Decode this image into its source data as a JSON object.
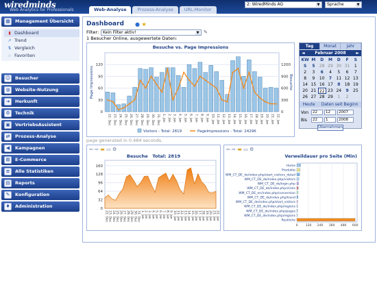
{
  "header": {
    "logo": "wiredminds",
    "tagline": "Web Analytics for Professionals",
    "tabs": [
      {
        "label": "Web-Analyse",
        "active": true
      },
      {
        "label": "Prozess-Analyse",
        "active": false
      },
      {
        "label": "URL-Monitor",
        "active": false
      }
    ],
    "company_select": "2: WiredMinds AG",
    "language_select": "Sprache"
  },
  "sidebar": {
    "items": [
      {
        "label": "Management Übersicht",
        "icon": "dashboard-icon"
      },
      {
        "label": "Besucher",
        "icon": "users-icon"
      },
      {
        "label": "Website-Nutzung",
        "icon": "globe-icon"
      },
      {
        "label": "Herkunft",
        "icon": "arrow-icon"
      },
      {
        "label": "Technik",
        "icon": "gear-icon"
      },
      {
        "label": "VertriebsAssistent",
        "icon": "briefcase-icon"
      },
      {
        "label": "Prozess-Analyse",
        "icon": "process-icon"
      },
      {
        "label": "Kampagnen",
        "icon": "megaphone-icon"
      },
      {
        "label": "E-Commerce",
        "icon": "cart-icon"
      },
      {
        "label": "Alle Statistiken",
        "icon": "list-icon"
      },
      {
        "label": "Reports",
        "icon": "report-icon"
      },
      {
        "label": "Konfiguration",
        "icon": "wrench-icon"
      },
      {
        "label": "Administration",
        "icon": "admin-icon"
      }
    ],
    "subitems": [
      {
        "label": "Dashboard",
        "icon": "bar-chart-icon",
        "active": true
      },
      {
        "label": "Trend",
        "icon": "trend-icon",
        "active": false
      },
      {
        "label": "Vergleich",
        "icon": "compare-icon",
        "active": false
      },
      {
        "label": "Favoriten",
        "icon": "star-icon",
        "active": false
      }
    ]
  },
  "main": {
    "title": "Dashboard",
    "filter_label": "Filter:",
    "filter_value": "Kein Filter aktiv!",
    "online_text": "1 Besucher Online, ausgewertete Daten:",
    "generated_note": "page generated in 0.484 seconds.",
    "lower_left_title": "Besuche",
    "lower_left_total": "Total: 2819",
    "lower_right_title": "Verweildauer pro Seite (Min)"
  },
  "calendar": {
    "tabs": [
      "Tag",
      "Monat",
      "Jahr"
    ],
    "month": "Februar 2008",
    "prev": "◄",
    "next": "►",
    "weekdays": [
      "KW",
      "M",
      "D",
      "M",
      "D",
      "F",
      "S",
      "S"
    ],
    "weeks": [
      [
        "5",
        "28",
        "29",
        "30",
        "31",
        "1",
        "2",
        "3"
      ],
      [
        "6",
        "4",
        "5",
        "6",
        "7",
        "8",
        "9",
        "10"
      ],
      [
        "7",
        "11",
        "12",
        "13",
        "14",
        "15",
        "16",
        "17"
      ],
      [
        "8",
        "18",
        "19",
        "20",
        "21",
        "22",
        "23",
        "24"
      ],
      [
        "9",
        "25",
        "26",
        "27",
        "28",
        "29",
        "1",
        "2"
      ]
    ],
    "link_today": "Heute",
    "link_since": "Daten seit Beginn",
    "from_label": "Von",
    "to_label": "Bis",
    "from": {
      "day": "22",
      "month": "12",
      "year": "2007"
    },
    "to": {
      "day": "22",
      "month": "1",
      "year": "2008"
    },
    "apply": "Übernehmen"
  },
  "chart_data": [
    {
      "type": "bar",
      "title": "Besuche vs. Page Impressions",
      "ylabel": "Page Impressions",
      "ylabel_right": "Besuche",
      "ylim": [
        0,
        150
      ],
      "ylim_right": [
        0,
        1500
      ],
      "yticks": [
        0,
        30,
        60,
        90,
        120
      ],
      "yticks_right": [
        0,
        300,
        600,
        900,
        1200
      ],
      "categories": [
        "22. Dec",
        "23. Dec",
        "24. Dec",
        "25. Dec",
        "26. Dec",
        "27. Dec",
        "28. Dec",
        "29. Dec",
        "30. Dec",
        "31. Dec",
        "1. Jan",
        "2. Jan",
        "3. Jan",
        "4. Jan",
        "5. Jan",
        "6. Jan",
        "7. Jan",
        "8. Jan",
        "9. Jan",
        "10. Jan",
        "11. Jan",
        "12. Jan",
        "13. Jan",
        "14. Jan",
        "15. Jan",
        "16. Jan",
        "17. Jan",
        "18. Jan",
        "19. Jan",
        "20. Jan",
        "21. Jan",
        "22. Jan"
      ],
      "series": [
        {
          "name": "Visitors",
          "legend": "Visitors - Total: 2819",
          "color": "#9cc6e6",
          "values": [
            50,
            48,
            18,
            20,
            40,
            62,
            110,
            108,
            112,
            88,
            100,
            112,
            112,
            92,
            62,
            120,
            110,
            126,
            100,
            118,
            102,
            80,
            44,
            130,
            140,
            90,
            132,
            102,
            88,
            60,
            62,
            60
          ]
        },
        {
          "name": "PageImpressions",
          "legend": "PageImpressions - Total: 24296",
          "color": "#f08a1e",
          "values": [
            300,
            250,
            50,
            100,
            200,
            300,
            800,
            600,
            900,
            700,
            500,
            1100,
            300,
            600,
            1000,
            800,
            650,
            900,
            800,
            700,
            600,
            300,
            250,
            1000,
            1100,
            600,
            1000,
            500,
            350,
            250,
            200,
            200
          ]
        }
      ]
    },
    {
      "type": "area",
      "title": "Besuche",
      "total": "Total: 2819",
      "ylim": [
        0,
        180
      ],
      "yticks": [
        0,
        32,
        64,
        96,
        128,
        160
      ],
      "categories": [
        "22. Dec",
        "23. Dec",
        "24. Dec",
        "25. Dec",
        "26. Dec",
        "27. Dec",
        "28. Dec",
        "29. Dec",
        "30. Dec",
        "31. Dec",
        "1. Jan",
        "2. Jan",
        "3. Jan",
        "4. Jan",
        "5. Jan",
        "6. Jan",
        "7. Jan",
        "8. Jan",
        "9. Jan",
        "10. Jan",
        "11. Jan",
        "12. Jan",
        "13. Jan",
        "14. Jan",
        "15. Jan",
        "16. Jan",
        "17. Jan",
        "18. Jan",
        "19. Jan",
        "20. Jan",
        "21. Jan",
        "22. Jan"
      ],
      "values": [
        40,
        50,
        35,
        30,
        55,
        72,
        118,
        126,
        106,
        82,
        96,
        120,
        121,
        88,
        60,
        115,
        124,
        132,
        102,
        128,
        104,
        70,
        54,
        144,
        152,
        92,
        130,
        100,
        86,
        60,
        58,
        64
      ],
      "color": "#f08a1e"
    },
    {
      "type": "bar",
      "orientation": "horizontal",
      "title": "Verweildauer pro Seite (Min)",
      "xticks": [
        0,
        120,
        240,
        360,
        480,
        600
      ],
      "xlim": [
        0,
        620
      ],
      "categories": [
        "Home",
        "Produkte",
        "WM_CT_DE_de/index.php/start_visitors_detail",
        "WM_CT_DE_de/index.php/visitors",
        "WM_CT_DE_de/login.php",
        "WM_CT_DE_de/index.php/clicks",
        "WM_CT_DE_en/index.php/conversion",
        "WM_CT_DE_de/index.php/trend",
        "WM_CT_DE_de/index.php/start_visitors",
        "WM_CT_DE_de/index.php/regions",
        "WM_CT_DE_de/index.php/pages",
        "WM_CT_DE_de/index.php/regions",
        "Restliche"
      ],
      "values": [
        40,
        35,
        30,
        22,
        18,
        15,
        14,
        12,
        10,
        9,
        8,
        8,
        600
      ],
      "colors": [
        "#9cc6e6",
        "#e3e08a",
        "#7fb7e0",
        "#b0d6ec",
        "#c0a3d8",
        "#d47a7a",
        "#b8e0b0",
        "#7fa6e0",
        "#e8b5c6",
        "#c9c9c9",
        "#a7d3d0",
        "#d8e2ef",
        "#f08a1e"
      ]
    }
  ]
}
